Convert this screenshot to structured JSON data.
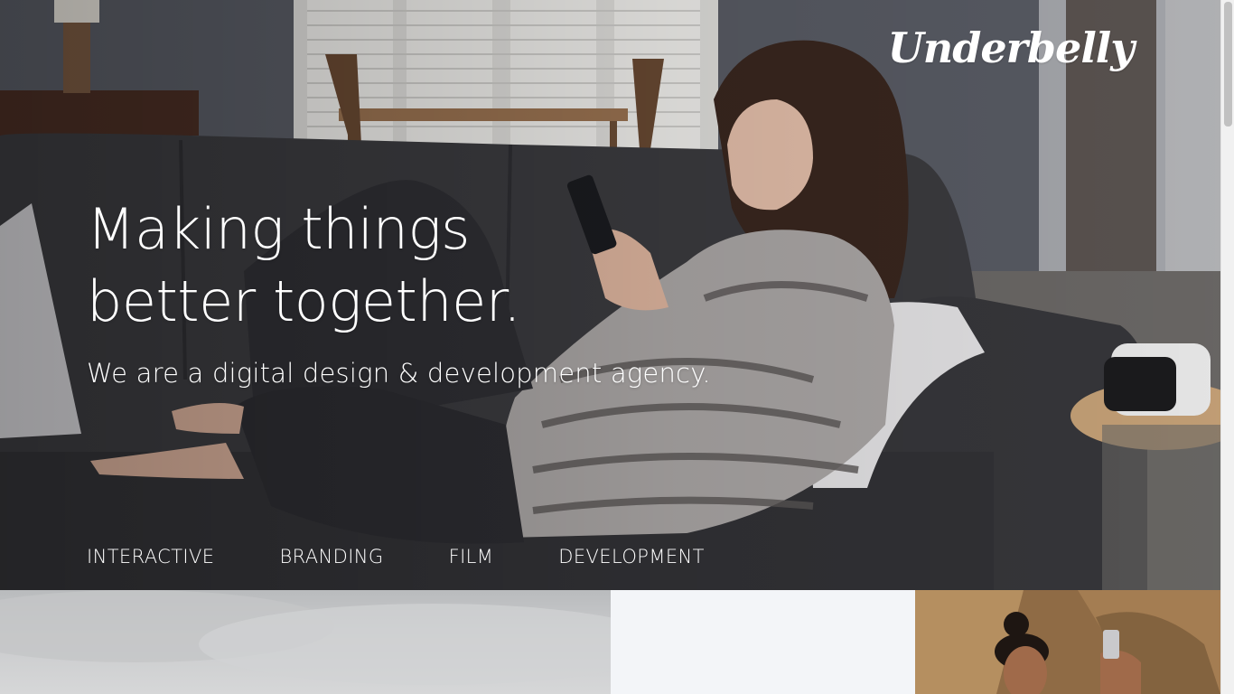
{
  "brand": {
    "logo_text": "Underbelly"
  },
  "hero": {
    "headline_line1": "Making things",
    "headline_line2": "better together.",
    "subline": "We are a digital design & development agency."
  },
  "nav": {
    "items": [
      "INTERACTIVE",
      "BRANDING",
      "FILM",
      "DEVELOPMENT"
    ]
  },
  "colors": {
    "hero_text": "#ffffff",
    "page_background": "#f3f5f8"
  }
}
